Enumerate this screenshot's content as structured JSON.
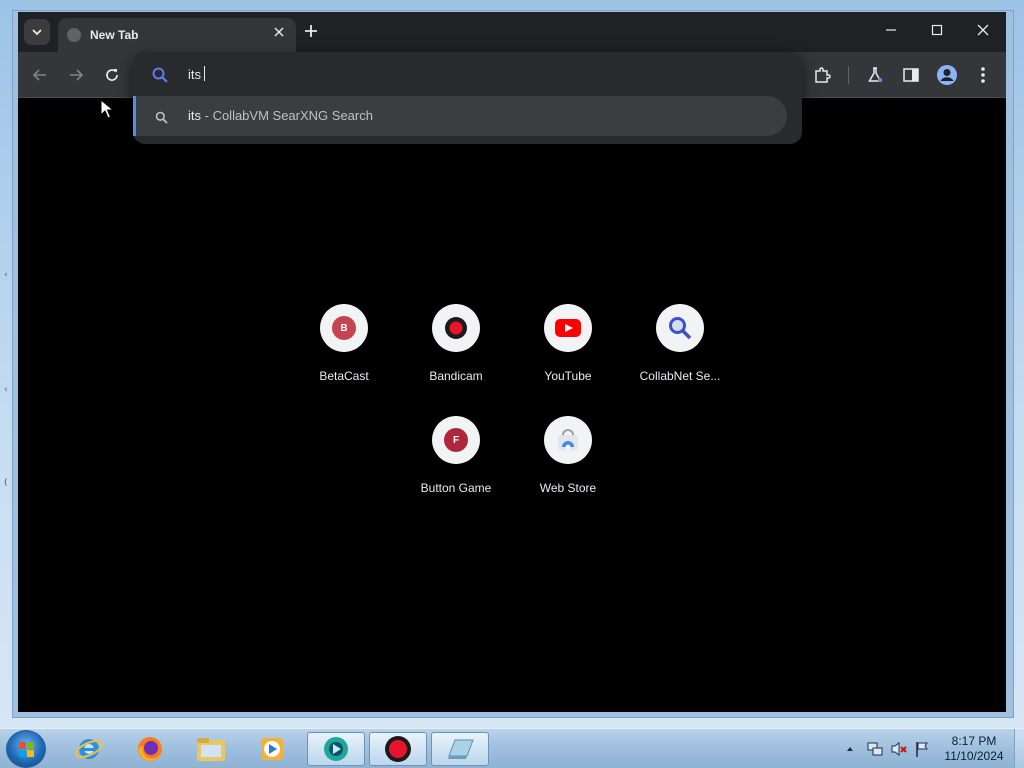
{
  "browser": {
    "tab": {
      "title": "New Tab"
    },
    "omnibox": {
      "input_value": "its",
      "suggestion": {
        "query": "its",
        "separator": " - ",
        "engine": "CollabVM SearXNG Search"
      }
    }
  },
  "shortcuts": [
    {
      "label": "BetaCast",
      "icon": "betacast-icon",
      "letter": "B",
      "color": "#c4444f"
    },
    {
      "label": "Bandicam",
      "icon": "bandicam-icon"
    },
    {
      "label": "YouTube",
      "icon": "youtube-icon",
      "color": "#ff0000"
    },
    {
      "label": "CollabNet Se...",
      "icon": "search-magnifier-icon"
    },
    {
      "label": "Button Game",
      "icon": "button-game-icon",
      "letter": "F",
      "color": "#b0263e"
    },
    {
      "label": "Web Store",
      "icon": "web-store-icon"
    }
  ],
  "taskbar": {
    "apps": [
      "internet-explorer-icon",
      "firefox-icon",
      "file-explorer-icon",
      "media-player-icon",
      "collabvm-app-icon",
      "bandicam-record-icon",
      "notepad-icon"
    ],
    "clock": {
      "time": "8:17 PM",
      "date": "11/10/2024"
    }
  },
  "colors": {
    "accent_blue": "#4c8df6",
    "page_bg": "#000000",
    "toolbar_bg": "#35363a"
  }
}
